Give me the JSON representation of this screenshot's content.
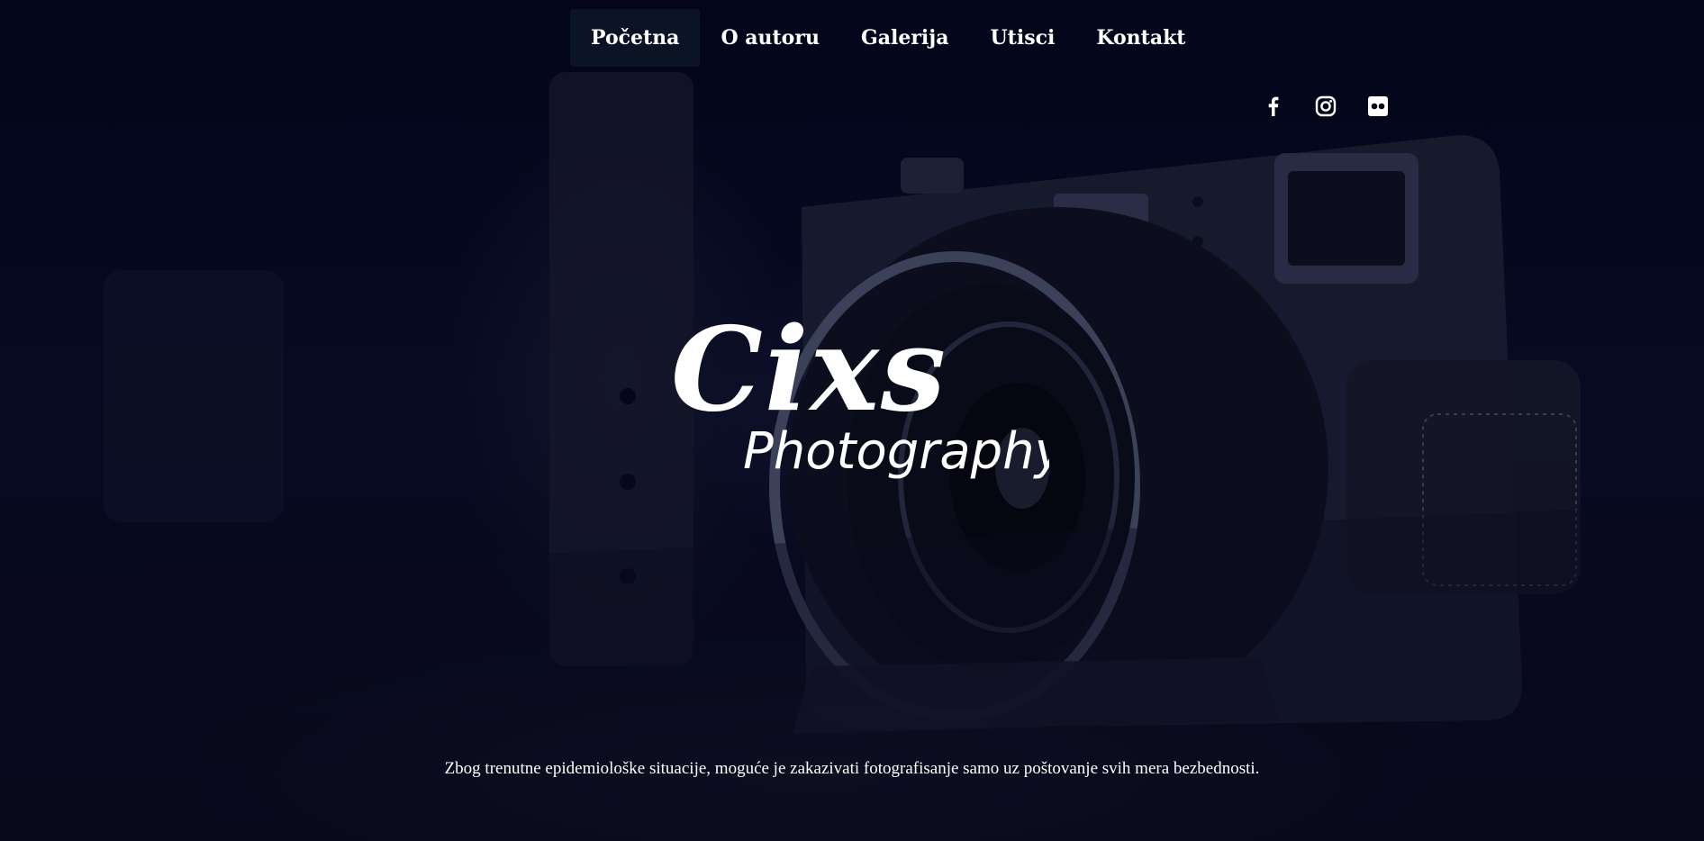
{
  "nav": {
    "items": [
      {
        "label": "Početna",
        "active": true
      },
      {
        "label": "O autoru",
        "active": false
      },
      {
        "label": "Galerija",
        "active": false
      },
      {
        "label": "Utisci",
        "active": false
      },
      {
        "label": "Kontakt",
        "active": false
      }
    ]
  },
  "social": {
    "icons": [
      "facebook-icon",
      "instagram-icon",
      "flickr-icon"
    ]
  },
  "logo": {
    "line1": "Cixs",
    "line2": "Photography"
  },
  "notice": {
    "text": "Zbog trenutne epidemiološke situacije, moguće je zakazivati fotografisanje samo uz poštovanje svih mera bezbednosti."
  },
  "colors": {
    "background": "#04061a",
    "nav_active_bg": "#0b1424",
    "text": "#ffffff"
  }
}
